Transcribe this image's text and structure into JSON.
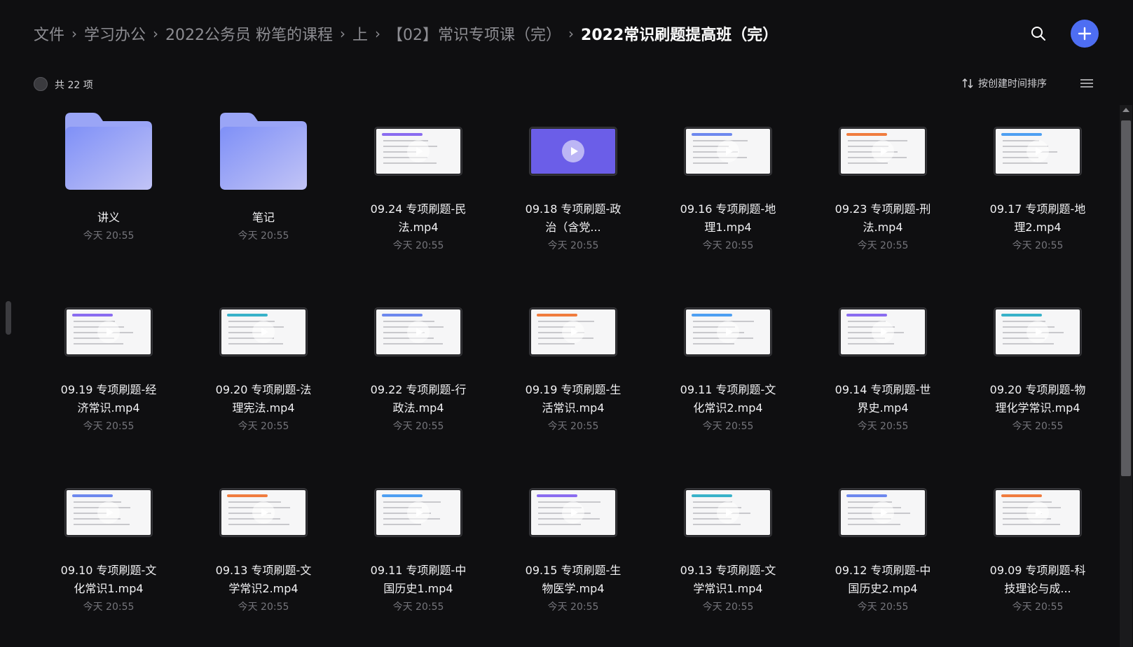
{
  "breadcrumb": {
    "items": [
      "文件",
      "学习办公",
      "2022公务员 粉笔的课程",
      "上",
      "【02】常识专项课（完）"
    ],
    "current": "2022常识刷题提高班（完）",
    "separator": "›"
  },
  "toolbar": {
    "count_label": "共 22 项",
    "sort_label": "按创建时间排序"
  },
  "icons": {
    "search": "search-icon",
    "add": "plus-icon",
    "sort": "sort-arrows-icon",
    "view": "list-view-icon",
    "folder": "folder-icon",
    "play": "play-icon"
  },
  "colors": {
    "accent": "#4e6ef2",
    "background": "#0f0f11",
    "folder": "#8f9bf5"
  },
  "items": [
    {
      "name": "讲义",
      "time": "今天 20:55",
      "type": "folder"
    },
    {
      "name": "笔记",
      "time": "今天 20:55",
      "type": "folder"
    },
    {
      "name": "09.24 专项刷题-民法.mp4",
      "time": "今天 20:55",
      "type": "video"
    },
    {
      "name": "09.18 专项刷题-政治（含党...",
      "time": "今天 20:55",
      "type": "video"
    },
    {
      "name": "09.16 专项刷题-地理1.mp4",
      "time": "今天 20:55",
      "type": "video"
    },
    {
      "name": "09.23 专项刷题-刑法.mp4",
      "time": "今天 20:55",
      "type": "video"
    },
    {
      "name": "09.17 专项刷题-地理2.mp4",
      "time": "今天 20:55",
      "type": "video"
    },
    {
      "name": "09.19 专项刷题-经济常识.mp4",
      "time": "今天 20:55",
      "type": "video"
    },
    {
      "name": "09.20 专项刷题-法理宪法.mp4",
      "time": "今天 20:55",
      "type": "video"
    },
    {
      "name": "09.22 专项刷题-行政法.mp4",
      "time": "今天 20:55",
      "type": "video"
    },
    {
      "name": "09.19 专项刷题-生活常识.mp4",
      "time": "今天 20:55",
      "type": "video"
    },
    {
      "name": "09.11 专项刷题-文化常识2.mp4",
      "time": "今天 20:55",
      "type": "video"
    },
    {
      "name": "09.14 专项刷题-世界史.mp4",
      "time": "今天 20:55",
      "type": "video"
    },
    {
      "name": "09.20 专项刷题-物理化学常识.mp4",
      "time": "今天 20:55",
      "type": "video"
    },
    {
      "name": "09.10 专项刷题-文化常识1.mp4",
      "time": "今天 20:55",
      "type": "video"
    },
    {
      "name": "09.13 专项刷题-文学常识2.mp4",
      "time": "今天 20:55",
      "type": "video"
    },
    {
      "name": "09.11 专项刷题-中国历史1.mp4",
      "time": "今天 20:55",
      "type": "video"
    },
    {
      "name": "09.15 专项刷题-生物医学.mp4",
      "time": "今天 20:55",
      "type": "video"
    },
    {
      "name": "09.13 专项刷题-文学常识1.mp4",
      "time": "今天 20:55",
      "type": "video"
    },
    {
      "name": "09.12 专项刷题-中国历史2.mp4",
      "time": "今天 20:55",
      "type": "video"
    },
    {
      "name": "09.09 专项刷题-科技理论与成...",
      "time": "今天 20:55",
      "type": "video"
    }
  ]
}
